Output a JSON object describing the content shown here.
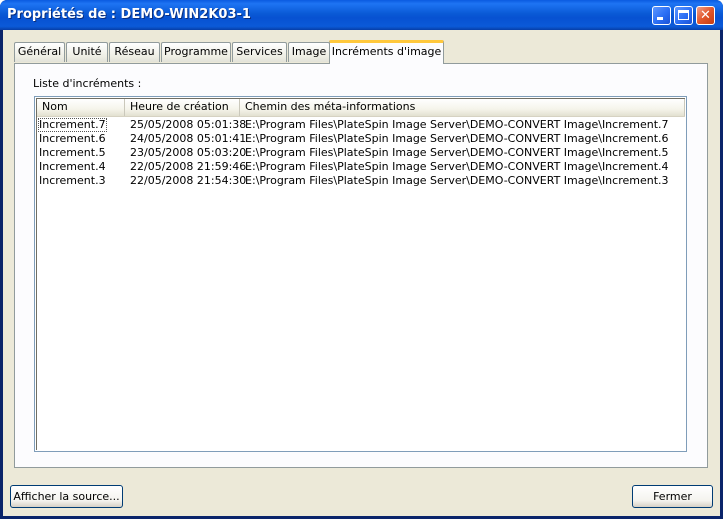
{
  "window": {
    "title": "Propriétés de : DEMO-WIN2K03-1",
    "min_label": "",
    "max_label": "",
    "close_label": "✕"
  },
  "tabs": [
    {
      "label": "Général"
    },
    {
      "label": "Unité"
    },
    {
      "label": "Réseau"
    },
    {
      "label": "Programme"
    },
    {
      "label": "Services"
    },
    {
      "label": "Image"
    },
    {
      "label": "Incréments d'image"
    }
  ],
  "active_tab": "Incréments d'image",
  "panel": {
    "list_label": "Liste d'incréments :",
    "columns": [
      "Nom",
      "Heure de création",
      "Chemin des méta-informations"
    ],
    "rows": [
      [
        "Increment.7",
        "25/05/2008 05:01:38",
        "E:\\Program Files\\PlateSpin Image Server\\DEMO-CONVERT Image\\Increment.7"
      ],
      [
        "Increment.6",
        "24/05/2008 05:01:41",
        "E:\\Program Files\\PlateSpin Image Server\\DEMO-CONVERT Image\\Increment.6"
      ],
      [
        "Increment.5",
        "23/05/2008 05:03:20",
        "E:\\Program Files\\PlateSpin Image Server\\DEMO-CONVERT Image\\Increment.5"
      ],
      [
        "Increment.4",
        "22/05/2008 21:59:46",
        "E:\\Program Files\\PlateSpin Image Server\\DEMO-CONVERT Image\\Increment.4"
      ],
      [
        "Increment.3",
        "22/05/2008 21:54:30",
        "E:\\Program Files\\PlateSpin Image Server\\DEMO-CONVERT Image\\Increment.3"
      ]
    ]
  },
  "footer": {
    "source_button": "Afficher la source...",
    "close_button": "Fermer"
  }
}
